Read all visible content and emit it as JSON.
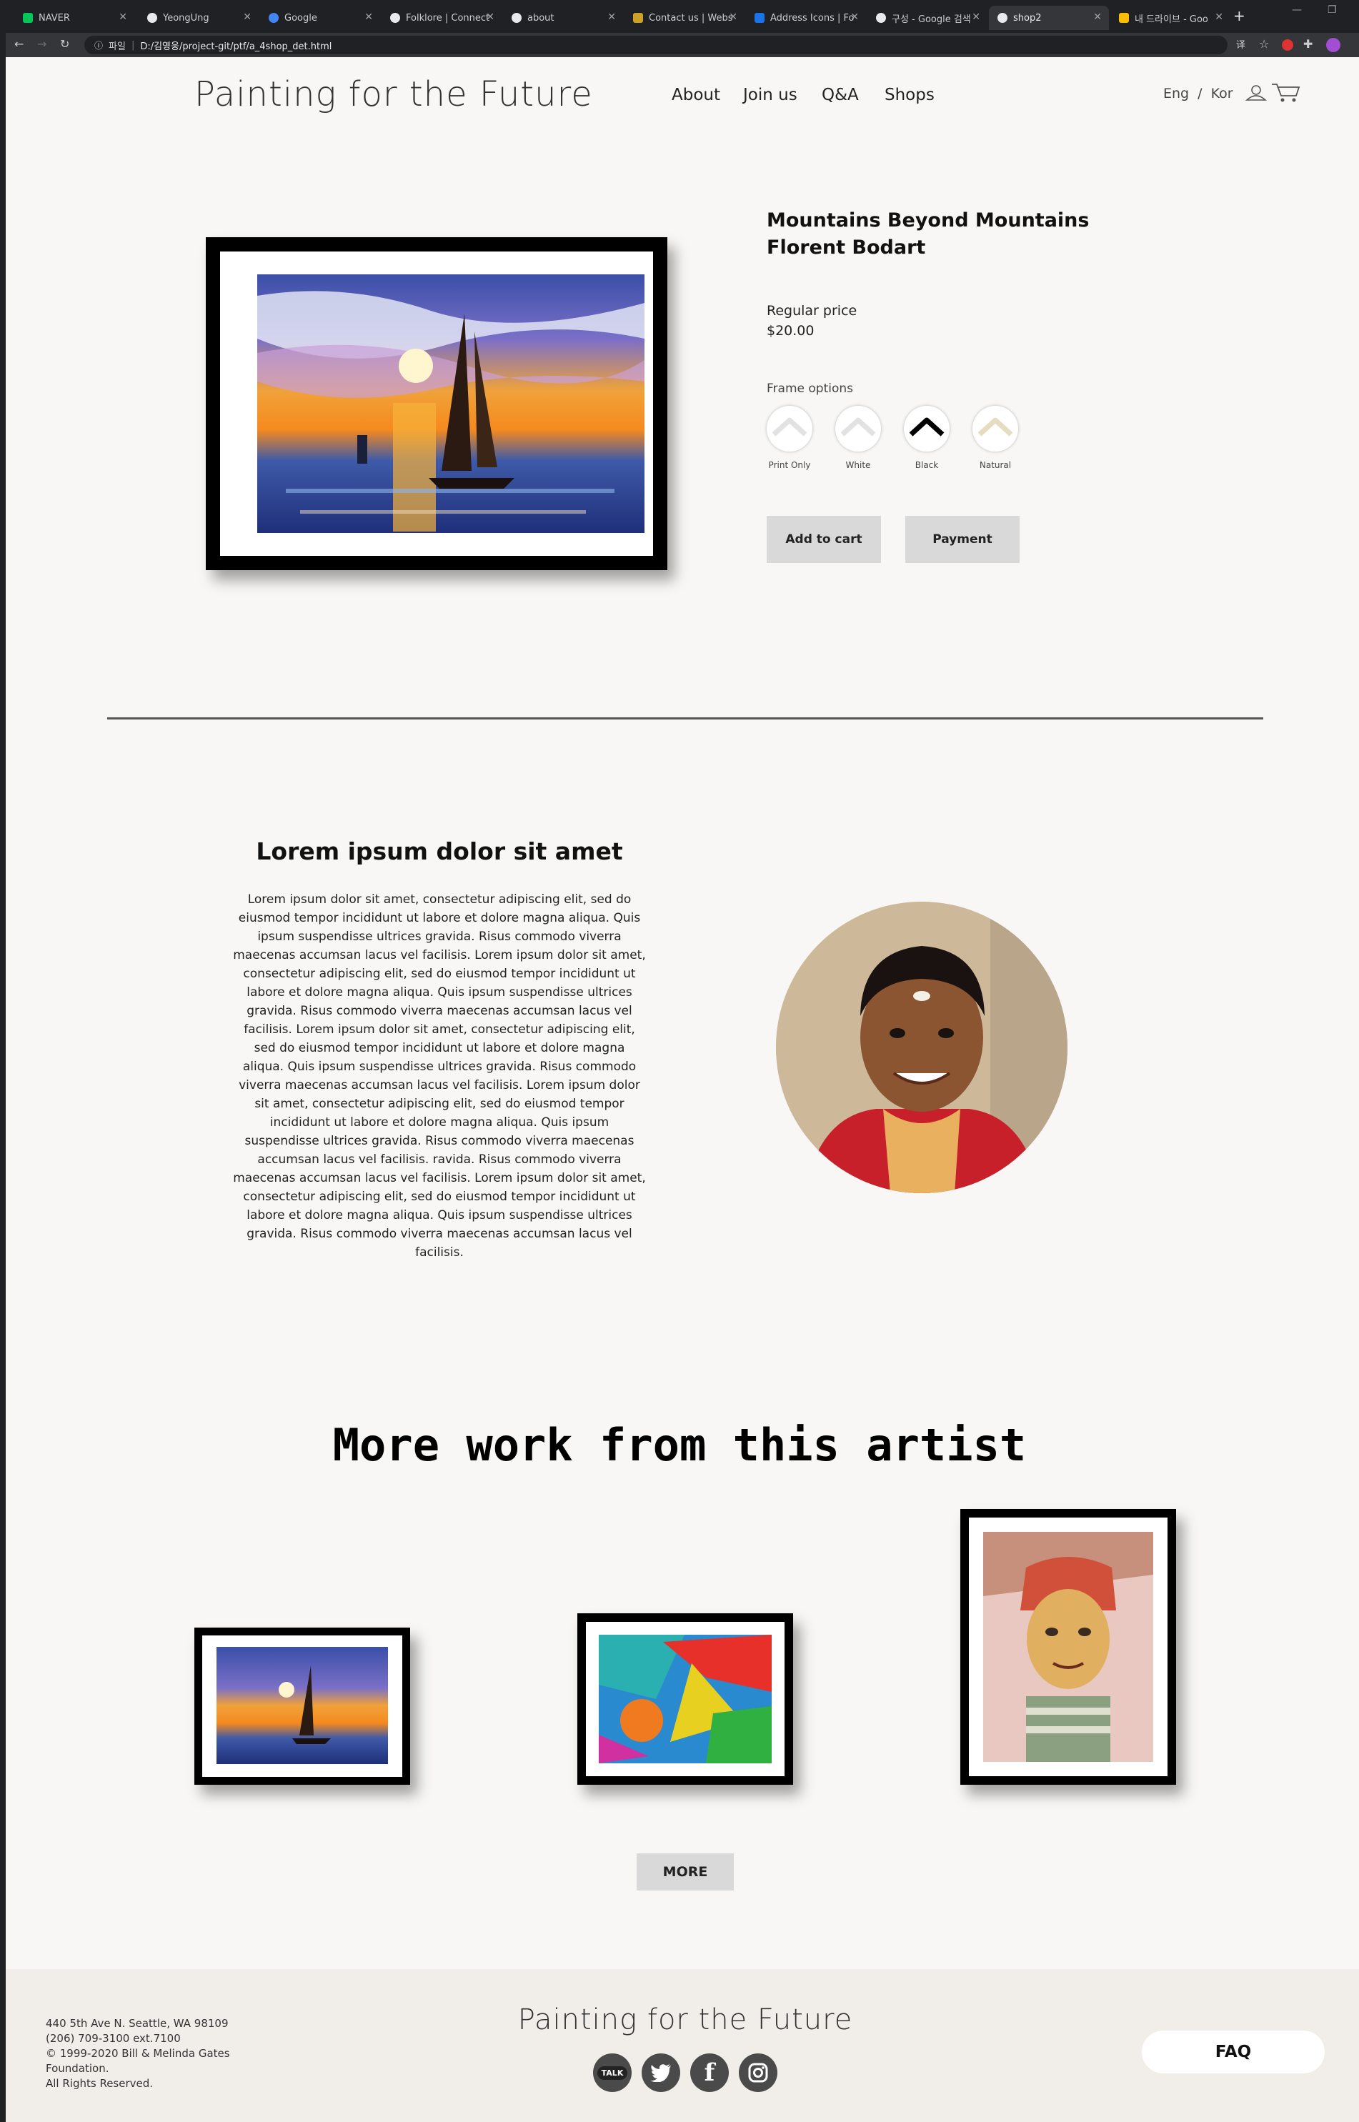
{
  "browser": {
    "tabs": [
      {
        "label": "NAVER",
        "color": "#03c75a"
      },
      {
        "label": "YeongUng",
        "color": "#e8eaed"
      },
      {
        "label": "Google",
        "color": "#4285f4"
      },
      {
        "label": "Folklore | Connect",
        "color": "#e8eaed"
      },
      {
        "label": "about",
        "color": "#e8eaed"
      },
      {
        "label": "Contact us | Webs",
        "color": "#c9a227"
      },
      {
        "label": "Address Icons | Fo",
        "color": "#1a73e8"
      },
      {
        "label": "구성 - Google 검색",
        "color": "#e8eaed"
      },
      {
        "label": "shop2",
        "color": "#e8eaed",
        "active": true
      },
      {
        "label": "내 드라이브 - Goo",
        "color": "#fbbc04"
      }
    ],
    "url_prefix": "파일",
    "url": "D:/김영웅/project-git/ptf/a_4shop_det.html"
  },
  "header": {
    "logo": "Painting for the Future",
    "nav": [
      "About",
      "Join us",
      "Q&A",
      "Shops"
    ],
    "lang_en": "Eng",
    "lang_sep": "/",
    "lang_ko": "Kor"
  },
  "product": {
    "title_line1": "Mountains Beyond Mountains",
    "title_line2": "Florent Bodart",
    "price_label": "Regular price",
    "price": "$20.00",
    "frame_options_label": "Frame options",
    "frame_options": [
      {
        "label": "Print Only",
        "color": "#dddddd"
      },
      {
        "label": "White",
        "color": "#dddddd"
      },
      {
        "label": "Black",
        "color": "#000000"
      },
      {
        "label": "Natural",
        "color": "#e6dcc0"
      }
    ],
    "add_to_cart": "Add to cart",
    "payment": "Payment"
  },
  "story": {
    "heading": "Lorem ipsum dolor sit amet",
    "body": "Lorem ipsum dolor sit amet, consectetur adipiscing elit, sed do eiusmod tempor incididunt ut labore et dolore magna aliqua. Quis ipsum suspendisse ultrices gravida. Risus commodo viverra maecenas accumsan lacus vel facilisis. Lorem ipsum dolor sit amet, consectetur adipiscing elit, sed do eiusmod tempor incididunt ut labore et dolore magna aliqua. Quis ipsum suspendisse ultrices gravida. Risus commodo viverra maecenas accumsan lacus vel facilisis. Lorem ipsum dolor sit amet, consectetur adipiscing elit, sed do eiusmod tempor incididunt ut labore et dolore magna aliqua. Quis ipsum suspendisse ultrices gravida. Risus commodo viverra maecenas accumsan lacus vel facilisis. Lorem ipsum dolor sit amet, consectetur adipiscing elit, sed do eiusmod tempor incididunt ut labore et dolore magna aliqua. Quis ipsum suspendisse ultrices gravida. Risus commodo viverra maecenas accumsan lacus vel facilisis. ravida. Risus commodo viverra maecenas accumsan lacus vel facilisis. Lorem ipsum dolor sit amet, consectetur adipiscing elit, sed do eiusmod tempor incididunt ut labore et dolore magna aliqua. Quis ipsum suspendisse ultrices gravida. Risus commodo viverra maecenas accumsan lacus vel facilisis."
  },
  "more": {
    "heading": "More work from this artist",
    "button": "MORE"
  },
  "footer": {
    "address_line1": "440 5th Ave N. Seattle, WA 98109",
    "address_line2": "(206) 709-3100 ext.7100",
    "address_line3": "© 1999-2020 Bill & Melinda Gates",
    "address_line4": "Foundation.",
    "address_line5": "All Rights Reserved.",
    "logo": "Painting for the Future",
    "kakao_label": "TALK",
    "faq": "FAQ"
  }
}
